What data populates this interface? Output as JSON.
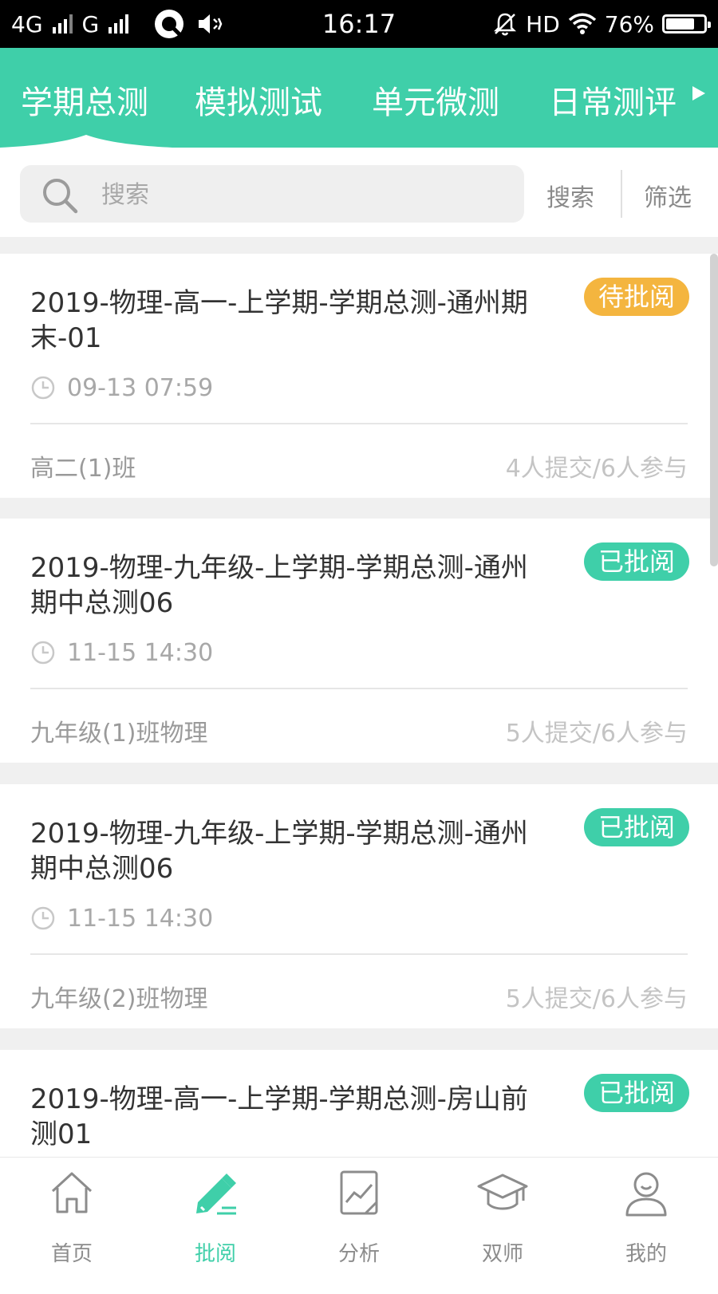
{
  "status_bar": {
    "network1": "4G",
    "network2": "G",
    "time": "16:17",
    "hd": "HD",
    "battery": "76%",
    "battery_level": 0.76
  },
  "tabs": [
    {
      "label": "学期总测",
      "active": true
    },
    {
      "label": "模拟测试",
      "active": false
    },
    {
      "label": "单元微测",
      "active": false
    },
    {
      "label": "日常测评",
      "active": false
    }
  ],
  "search": {
    "placeholder": "搜索",
    "search_label": "搜索",
    "filter_label": "筛选"
  },
  "colors": {
    "accent": "#3fcfa9",
    "pending": "#f4b53f",
    "reviewed": "#3fcfa9"
  },
  "items": [
    {
      "title": "2019-物理-高一-上学期-学期总测-通州期末-01",
      "status": "待批阅",
      "status_type": "pending",
      "time": "09-13 07:59",
      "class_name": "高二(1)班",
      "stats": "4人提交/6人参与"
    },
    {
      "title": "2019-物理-九年级-上学期-学期总测-通州期中总测06",
      "status": "已批阅",
      "status_type": "reviewed",
      "time": "11-15 14:30",
      "class_name": "九年级(1)班物理",
      "stats": "5人提交/6人参与"
    },
    {
      "title": "2019-物理-九年级-上学期-学期总测-通州期中总测06",
      "status": "已批阅",
      "status_type": "reviewed",
      "time": "11-15 14:30",
      "class_name": "九年级(2)班物理",
      "stats": "5人提交/6人参与"
    },
    {
      "title": "2019-物理-高一-上学期-学期总测-房山前测01",
      "status": "已批阅",
      "status_type": "reviewed",
      "time": "",
      "class_name": "",
      "stats": ""
    }
  ],
  "bottom_nav": [
    {
      "label": "首页",
      "icon": "home-icon",
      "active": false
    },
    {
      "label": "批阅",
      "icon": "pencil-icon",
      "active": true
    },
    {
      "label": "分析",
      "icon": "chart-icon",
      "active": false
    },
    {
      "label": "双师",
      "icon": "graduation-cap-icon",
      "active": false
    },
    {
      "label": "我的",
      "icon": "user-icon",
      "active": false
    }
  ]
}
